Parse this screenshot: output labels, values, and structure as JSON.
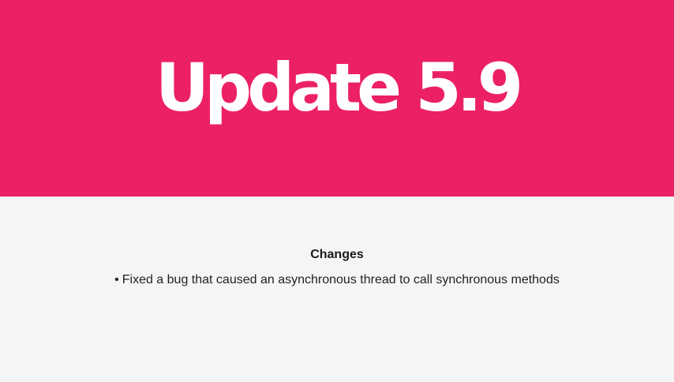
{
  "header": {
    "title": "Update 5.9",
    "background_color": "#ec2066",
    "text_color": "#ffffff"
  },
  "changes": {
    "heading": "Changes",
    "bullet": "•",
    "items": [
      "Fixed a bug that caused an asynchronous thread to call synchronous methods"
    ]
  },
  "body_background": "#f4f5f7"
}
